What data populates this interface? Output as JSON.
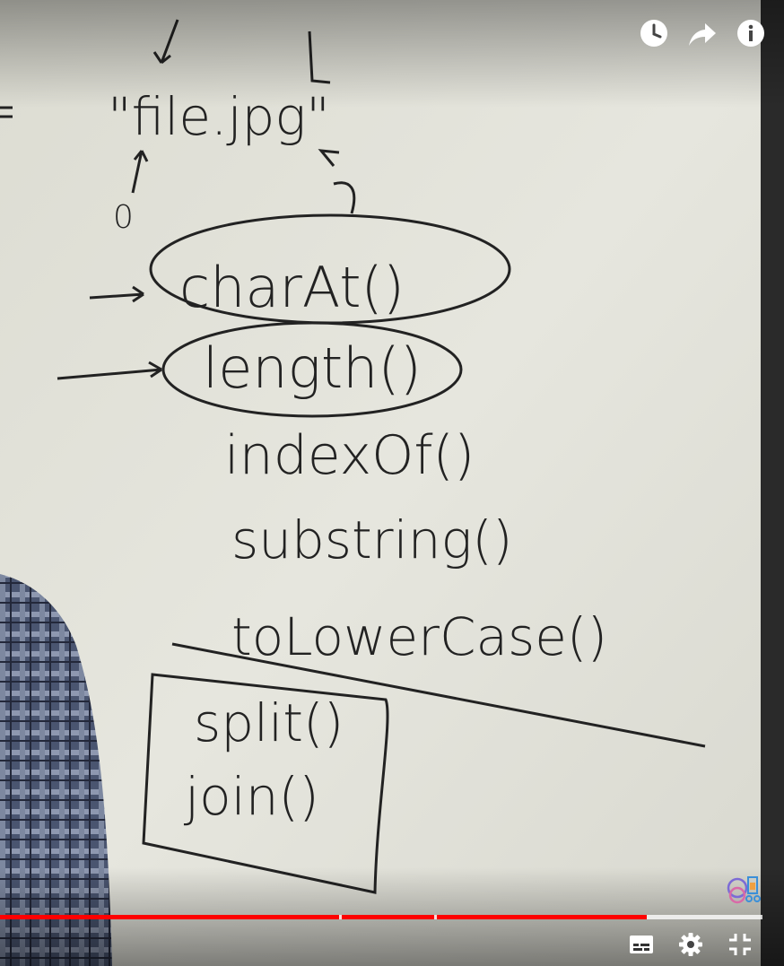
{
  "video": {
    "progress": {
      "played_fraction": 0.848,
      "buffered_fraction": 1.0,
      "chapter_markers": [
        0.445,
        0.569
      ]
    },
    "colors": {
      "played": "#ff0000",
      "board": "#e4e4dc"
    }
  },
  "whiteboard": {
    "top_quote": "\"file.jpg\"",
    "index_zero": "0",
    "methods": [
      "charAt()",
      "length()",
      "indexOf()",
      "substring()",
      "toLowerCase()"
    ],
    "boxed_methods": [
      "split()",
      "join()"
    ]
  },
  "icons": {
    "top_right": [
      "watch-later-icon",
      "share-icon",
      "info-icon"
    ],
    "bottom_right": [
      "subtitles-icon",
      "settings-icon",
      "exit-fullscreen-icon"
    ]
  }
}
